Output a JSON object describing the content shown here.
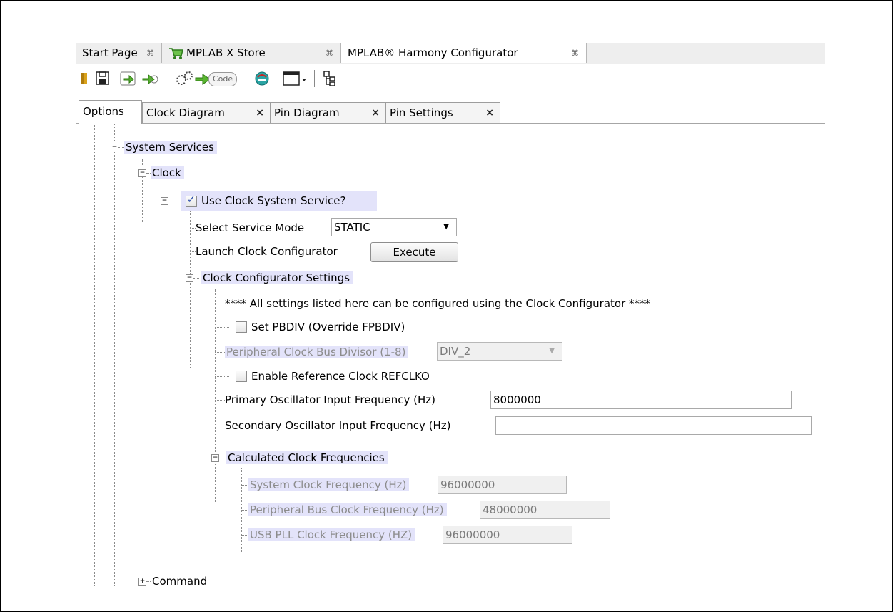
{
  "editor_tabs": [
    {
      "label": "Start Page"
    },
    {
      "label": "MPLAB X Store"
    },
    {
      "label": "MPLAB® Harmony Configurator"
    }
  ],
  "tab_close_glyph": "⌘",
  "toolbar": {
    "code_label": "Code",
    "icons": [
      "open-project-icon",
      "save-icon",
      "export-icon",
      "import-icon",
      "generate-code-icon",
      "harmony-help-icon",
      "window-layout-icon",
      "tree-view-icon"
    ]
  },
  "sub_tabs": [
    {
      "label": "Options"
    },
    {
      "label": "Clock Diagram"
    },
    {
      "label": "Pin Diagram"
    },
    {
      "label": "Pin Settings"
    }
  ],
  "sub_tab_close_glyph": "×",
  "tree": {
    "system_services": "System Services",
    "clock": "Clock",
    "use_clock": {
      "label": "Use Clock System Service?",
      "checked": true
    },
    "service_mode": {
      "label": "Select Service Mode",
      "value": "STATIC"
    },
    "launch": {
      "label": "Launch Clock Configurator",
      "button": "Execute"
    },
    "configurator_settings": "Clock Configurator Settings",
    "note": "**** All settings listed here can be configured using the Clock Configurator ****",
    "set_pbdiv": {
      "label": "Set PBDIV (Override FPBDIV)",
      "checked": false
    },
    "pb_divisor": {
      "label": "Peripheral Clock Bus Divisor (1-8)",
      "value": "DIV_2"
    },
    "refclko": {
      "label": "Enable Reference Clock REFCLKO",
      "checked": false
    },
    "primary_osc": {
      "label": "Primary Oscillator Input Frequency (Hz)",
      "value": "8000000"
    },
    "secondary_osc": {
      "label": "Secondary Oscillator Input Frequency (Hz)",
      "value": ""
    },
    "calculated": "Calculated Clock Frequencies",
    "sys_clock": {
      "label": "System Clock Frequency (Hz)",
      "value": "96000000"
    },
    "pb_clock": {
      "label": "Peripheral Bus Clock Frequency (Hz)",
      "value": "48000000"
    },
    "usb_pll": {
      "label": "USB PLL Clock Frequency (HZ)",
      "value": "96000000"
    },
    "command": "Command"
  },
  "colors": {
    "highlight": "#e3e3fa",
    "accent": "#1b3fa6"
  }
}
